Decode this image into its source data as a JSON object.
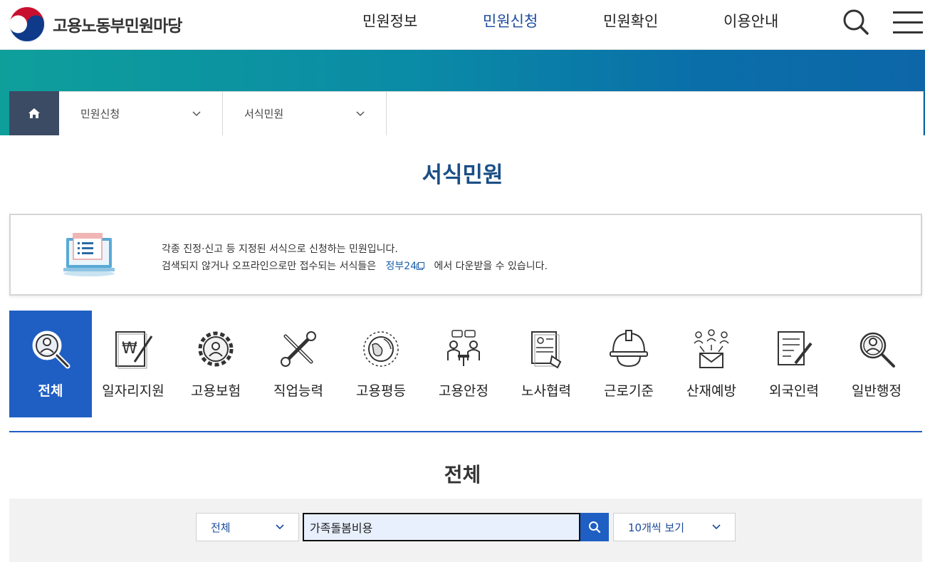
{
  "header": {
    "logo_text": "고용노동부민원마당",
    "nav": [
      {
        "label": "민원정보",
        "active": false
      },
      {
        "label": "민원신청",
        "active": true
      },
      {
        "label": "민원확인",
        "active": false
      },
      {
        "label": "이용안내",
        "active": false
      }
    ],
    "search_icon": "search-icon",
    "menu_icon": "hamburger-menu-icon"
  },
  "breadcrumb": {
    "home_icon": "home-icon",
    "level1": "민원신청",
    "level2": "서식민원"
  },
  "page": {
    "title": "서식민원",
    "section_title": "전체"
  },
  "notice": {
    "line1": "각종 진정·신고 등 지정된 서식으로 신청하는 민원입니다.",
    "line2_before": "검색되지 않거나 오프라인으로만 접수되는 서식들은",
    "link_text": "정부24",
    "line2_after": "에서 다운받을 수 있습니다."
  },
  "categories": [
    {
      "label": "전체",
      "icon": "magnifier-person-icon",
      "active": true
    },
    {
      "label": "일자리지원",
      "icon": "document-won-pen-icon",
      "active": false
    },
    {
      "label": "고용보험",
      "icon": "gear-person-icon",
      "active": false
    },
    {
      "label": "직업능력",
      "icon": "wrench-screwdriver-icon",
      "active": false
    },
    {
      "label": "고용평등",
      "icon": "globe-cycle-icon",
      "active": false
    },
    {
      "label": "고용안정",
      "icon": "meeting-people-icon",
      "active": false
    },
    {
      "label": "노사협력",
      "icon": "document-hand-icon",
      "active": false
    },
    {
      "label": "근로기준",
      "icon": "hard-hat-icon",
      "active": false
    },
    {
      "label": "산재예방",
      "icon": "people-envelope-icon",
      "active": false
    },
    {
      "label": "외국인력",
      "icon": "form-pen-icon",
      "active": false
    },
    {
      "label": "일반행정",
      "icon": "magnifier-person-icon",
      "active": false
    }
  ],
  "search": {
    "category_select": "전체",
    "query": "가족돌봄비용",
    "per_page_select": "10개씩 보기"
  },
  "colors": {
    "accent": "#1f5fc3",
    "title": "#1b4f86",
    "breadcrumb_home": "#3b4b63"
  }
}
